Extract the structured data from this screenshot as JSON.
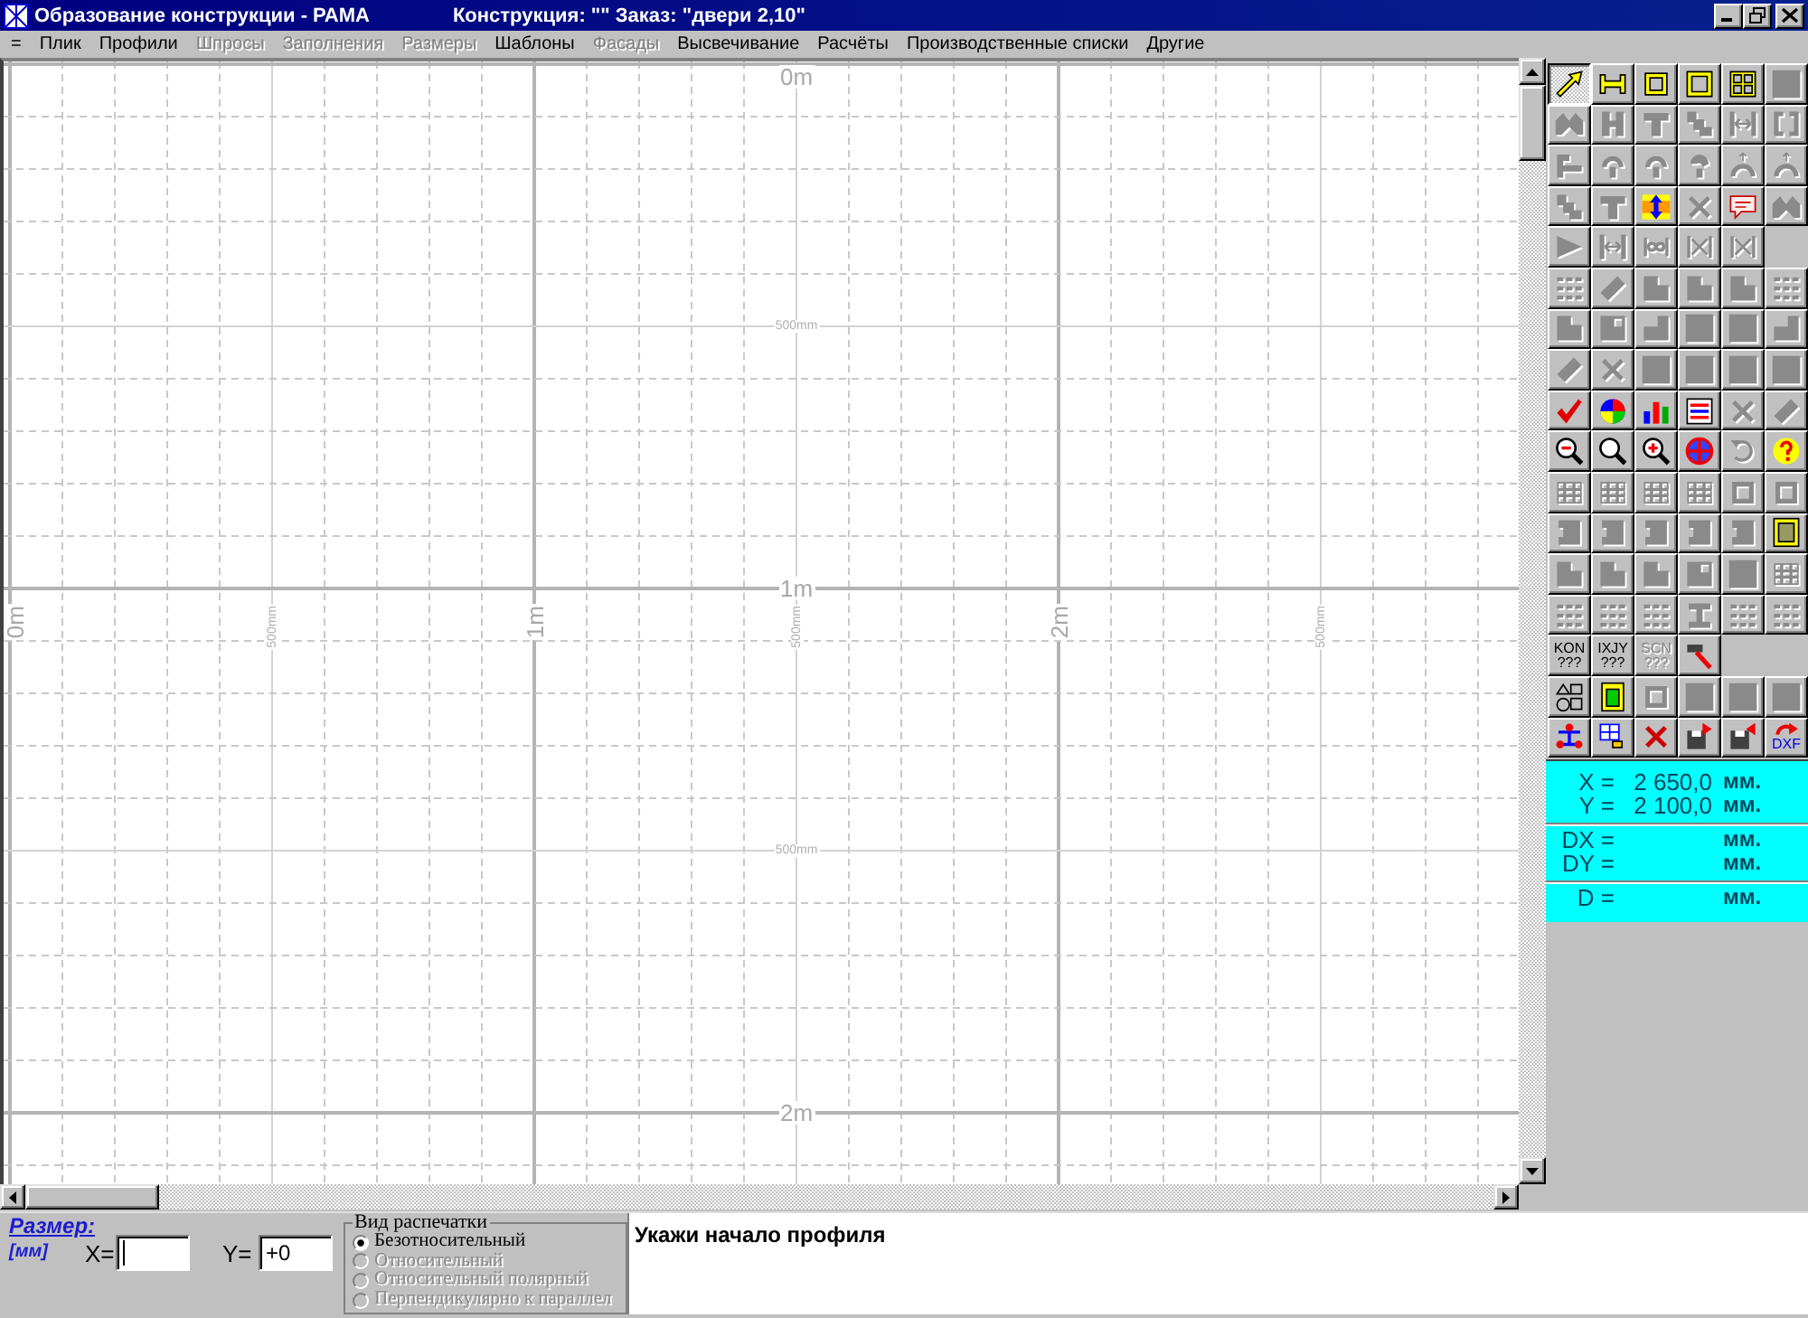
{
  "window": {
    "title": "Образование конструкции - РАМА",
    "context": "Конструкция: \"\" Заказ: \"двери 2,10\""
  },
  "menu": [
    {
      "label": "=",
      "disabled": false
    },
    {
      "label": "Плик",
      "disabled": false
    },
    {
      "label": "Профили",
      "disabled": false
    },
    {
      "label": "Шпросы",
      "disabled": true
    },
    {
      "label": "Заполнения",
      "disabled": true
    },
    {
      "label": "Размеры",
      "disabled": true
    },
    {
      "label": "Шаблоны",
      "disabled": false
    },
    {
      "label": "Фасады",
      "disabled": true
    },
    {
      "label": "Высвечивание",
      "disabled": false
    },
    {
      "label": "Расчёты",
      "disabled": false
    },
    {
      "label": "Производственные списки",
      "disabled": false
    },
    {
      "label": "Другие",
      "disabled": false
    }
  ],
  "canvas": {
    "row_labels": [
      "0m",
      "500mm",
      "1m",
      "500mm",
      "2m"
    ],
    "column_labels": [
      "0m",
      "500mm",
      "1m",
      "500mm",
      "2m",
      "500mm"
    ]
  },
  "toolbar": {
    "rows": [
      [
        {
          "selected": true,
          "disabled": false
        },
        {
          "selected": false,
          "disabled": false
        },
        {
          "selected": false,
          "disabled": false
        },
        {
          "selected": false,
          "disabled": false
        },
        {
          "selected": false,
          "disabled": false
        },
        {
          "selected": false,
          "disabled": true
        }
      ],
      [
        {
          "selected": false,
          "disabled": true
        },
        {
          "selected": false,
          "disabled": true
        },
        {
          "selected": false,
          "disabled": true
        },
        {
          "selected": false,
          "disabled": true
        },
        {
          "selected": false,
          "disabled": true
        },
        {
          "selected": false,
          "disabled": true
        }
      ],
      [
        {
          "selected": false,
          "disabled": true
        },
        {
          "selected": false,
          "disabled": true
        },
        {
          "selected": false,
          "disabled": true
        },
        {
          "selected": false,
          "disabled": true
        },
        {
          "selected": false,
          "disabled": true
        },
        {
          "selected": false,
          "disabled": true
        }
      ],
      [
        {
          "selected": false,
          "disabled": true
        },
        {
          "selected": false,
          "disabled": true
        },
        {
          "selected": false,
          "disabled": false
        },
        {
          "selected": false,
          "disabled": true
        },
        {
          "selected": false,
          "disabled": false
        },
        {
          "selected": false,
          "disabled": true
        }
      ],
      [
        {
          "selected": false,
          "disabled": true
        },
        {
          "selected": false,
          "disabled": true
        },
        {
          "selected": false,
          "disabled": true
        },
        {
          "selected": false,
          "disabled": true
        },
        {
          "selected": false,
          "disabled": true
        }
      ],
      [
        {
          "selected": false,
          "disabled": true
        },
        {
          "selected": false,
          "disabled": true
        },
        {
          "selected": false,
          "disabled": true
        },
        {
          "selected": false,
          "disabled": true
        },
        {
          "selected": false,
          "disabled": true
        },
        {
          "selected": false,
          "disabled": true
        }
      ],
      [
        {
          "selected": false,
          "disabled": true
        },
        {
          "selected": false,
          "disabled": true
        },
        {
          "selected": false,
          "disabled": true
        },
        {
          "selected": false,
          "disabled": true
        },
        {
          "selected": false,
          "disabled": true
        },
        {
          "selected": false,
          "disabled": true
        }
      ],
      [
        {
          "selected": false,
          "disabled": true
        },
        {
          "selected": false,
          "disabled": true
        },
        {
          "selected": false,
          "disabled": true
        },
        {
          "selected": false,
          "disabled": true
        },
        {
          "selected": false,
          "disabled": true
        },
        {
          "selected": false,
          "disabled": true
        }
      ],
      [
        {
          "selected": false,
          "disabled": false
        },
        {
          "selected": false,
          "disabled": false
        },
        {
          "selected": false,
          "disabled": false
        },
        {
          "selected": false,
          "disabled": false
        },
        {
          "selected": false,
          "disabled": true
        },
        {
          "selected": false,
          "disabled": true
        }
      ],
      [
        {
          "selected": false,
          "disabled": false
        },
        {
          "selected": false,
          "disabled": false
        },
        {
          "selected": false,
          "disabled": false
        },
        {
          "selected": false,
          "disabled": false
        },
        {
          "selected": false,
          "disabled": true
        },
        {
          "selected": false,
          "disabled": false
        }
      ],
      [
        {
          "selected": false,
          "disabled": true
        },
        {
          "selected": false,
          "disabled": true
        },
        {
          "selected": false,
          "disabled": true
        },
        {
          "selected": false,
          "disabled": true
        },
        {
          "selected": false,
          "disabled": true
        },
        {
          "selected": false,
          "disabled": true
        }
      ],
      [
        {
          "selected": false,
          "disabled": true
        },
        {
          "selected": false,
          "disabled": true
        },
        {
          "selected": false,
          "disabled": true
        },
        {
          "selected": false,
          "disabled": true
        },
        {
          "selected": false,
          "disabled": true
        },
        {
          "selected": false,
          "disabled": false
        }
      ],
      [
        {
          "selected": false,
          "disabled": true
        },
        {
          "selected": false,
          "disabled": true
        },
        {
          "selected": false,
          "disabled": true
        },
        {
          "selected": false,
          "disabled": true
        },
        {
          "selected": false,
          "disabled": true
        },
        {
          "selected": false,
          "disabled": true
        }
      ],
      [
        {
          "selected": false,
          "disabled": true
        },
        {
          "selected": false,
          "disabled": true
        },
        {
          "selected": false,
          "disabled": true
        },
        {
          "selected": false,
          "disabled": true
        },
        {
          "selected": false,
          "disabled": true
        },
        {
          "selected": false,
          "disabled": true
        }
      ],
      [
        {
          "label": "KON ???",
          "selected": false,
          "disabled": false
        },
        {
          "label": "IXJY ???",
          "selected": false,
          "disabled": false
        },
        {
          "label": "SCN ???",
          "selected": false,
          "disabled": true
        },
        {
          "selected": false,
          "disabled": false
        }
      ],
      [
        {
          "selected": false,
          "disabled": false
        },
        {
          "selected": false,
          "disabled": false
        },
        {
          "selected": false,
          "disabled": true
        },
        {
          "selected": false,
          "disabled": true
        },
        {
          "selected": false,
          "disabled": true
        },
        {
          "selected": false,
          "disabled": true
        }
      ],
      [
        {
          "selected": false,
          "disabled": false
        },
        {
          "selected": false,
          "disabled": false
        },
        {
          "selected": false,
          "disabled": false
        },
        {
          "selected": false,
          "disabled": false
        },
        {
          "selected": false,
          "disabled": false
        },
        {
          "label": "DXF",
          "selected": false,
          "disabled": false
        }
      ]
    ]
  },
  "coordinates": {
    "sections": [
      [
        {
          "label": "X =",
          "value": "2 650,0",
          "unit": "мм."
        },
        {
          "label": "Y =",
          "value": "2 100,0",
          "unit": "мм."
        }
      ],
      [
        {
          "label": "DX =",
          "unit": "мм."
        },
        {
          "label": "DY =",
          "unit": "мм."
        }
      ],
      [
        {
          "label": "D =",
          "unit": "мм."
        }
      ]
    ]
  },
  "size_input": {
    "label": "Размер:",
    "unit": "[мм]",
    "fields": [
      {
        "label": "X=",
        "focused": true
      },
      {
        "label": "Y=",
        "value": "+0",
        "focused": false
      }
    ]
  },
  "print_mode": {
    "title": "Вид распечатки",
    "options": [
      {
        "label": "Безотносительный",
        "selected": true,
        "disabled": false
      },
      {
        "label": "Относительный",
        "selected": false,
        "disabled": true
      },
      {
        "label": "Относительный полярный",
        "selected": false,
        "disabled": true
      },
      {
        "label": "Перпендикулярно к параллел",
        "selected": false,
        "disabled": true
      }
    ]
  },
  "status": {
    "message": "Укажи начало профиля"
  }
}
